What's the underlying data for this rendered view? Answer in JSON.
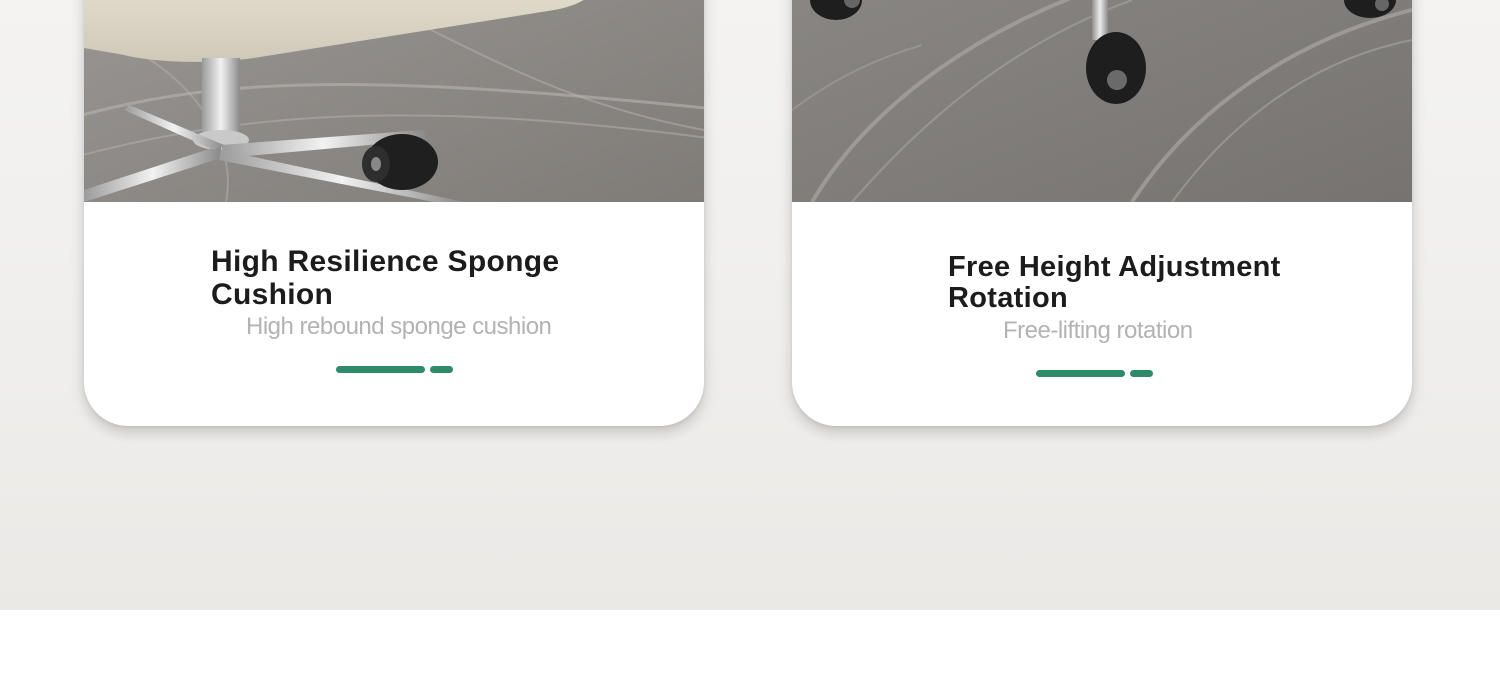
{
  "cards": [
    {
      "title": "High Resilience Sponge Cushion",
      "subtitle": "High rebound sponge cushion",
      "image_label": "chair-base-with-cushion-photo"
    },
    {
      "title": "Free Height Adjustment Rotation",
      "subtitle": "Free-lifting rotation",
      "image_label": "chair-wheels-on-rug-photo"
    }
  ],
  "colors": {
    "accent": "#2e8b6a",
    "title": "#1c1c1c",
    "subtitle": "#b3b3b3",
    "background": "#f0efed"
  }
}
